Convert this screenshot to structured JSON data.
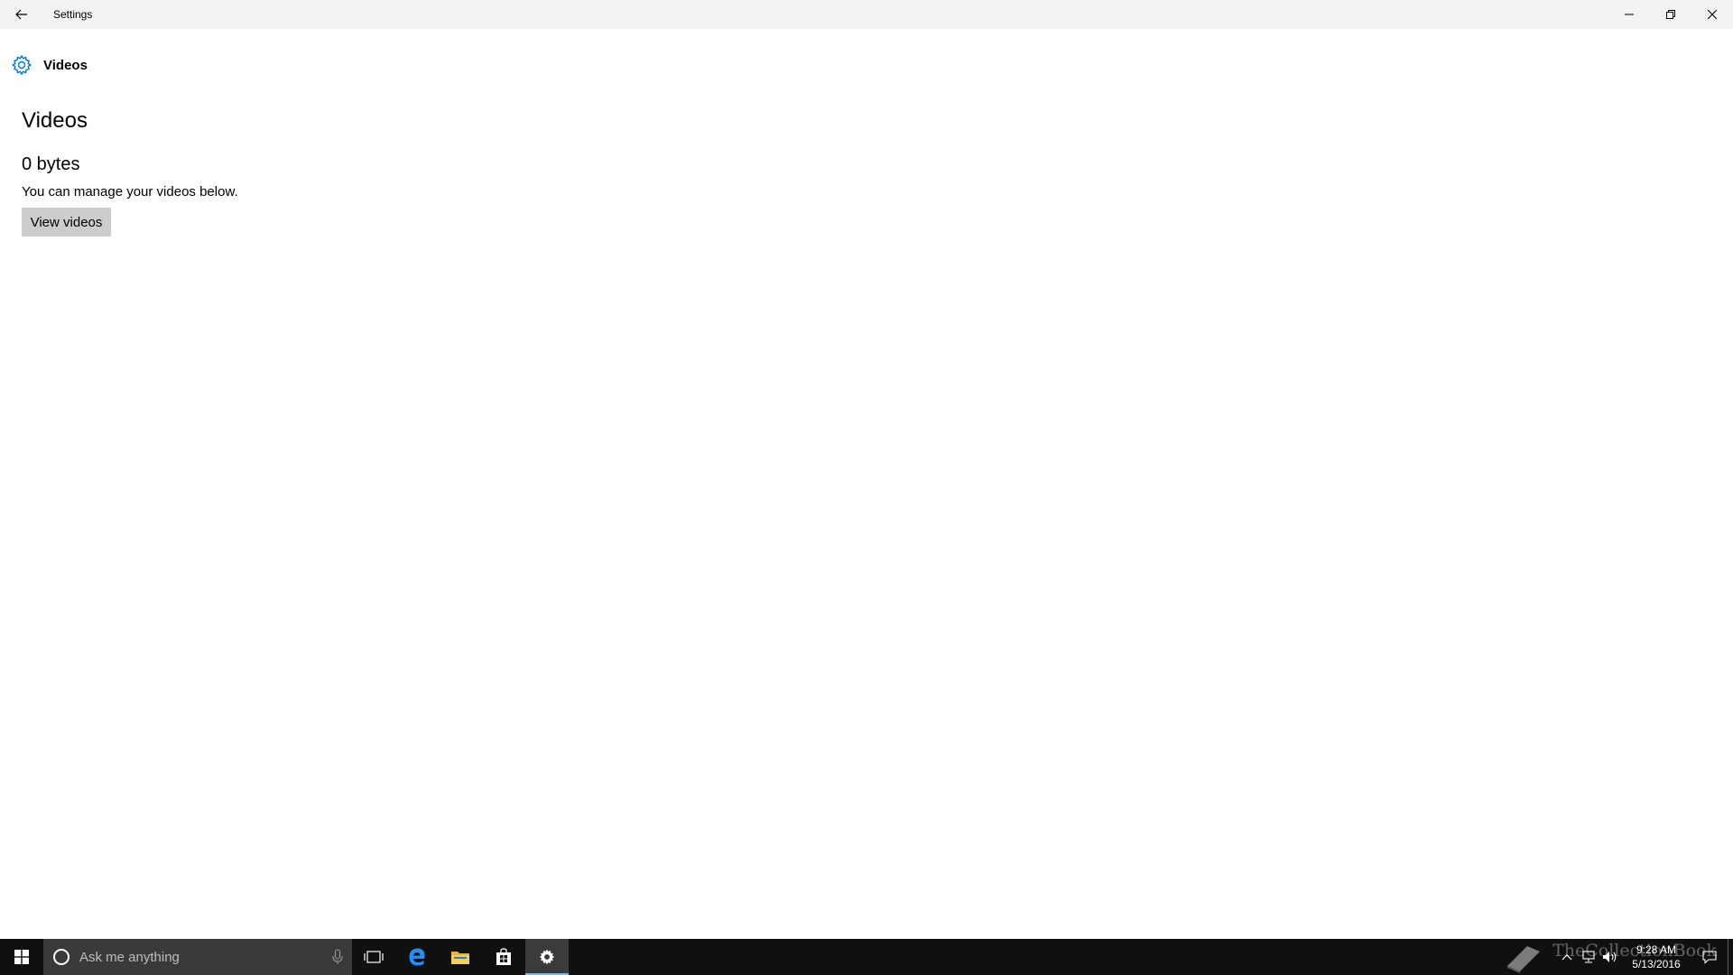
{
  "window": {
    "title": "Settings"
  },
  "header": {
    "title": "Videos"
  },
  "main": {
    "title": "Videos",
    "size": "0 bytes",
    "description": "You can manage your videos below.",
    "view_button": "View videos"
  },
  "taskbar": {
    "search_placeholder": "Ask me anything",
    "apps": [
      "task-view-icon",
      "edge-icon",
      "file-explorer-icon",
      "store-icon",
      "settings-icon"
    ],
    "active_app": "settings-icon",
    "accent": "#76b9ed"
  },
  "tray": {
    "time": "9:28 AM",
    "date": "5/13/2016",
    "watermark": "TheCollectionBook"
  },
  "colors": {
    "accent": "#0078d7",
    "titlebar": "#f2f2f2",
    "taskbar": "#101010",
    "button": "#cccccc"
  }
}
